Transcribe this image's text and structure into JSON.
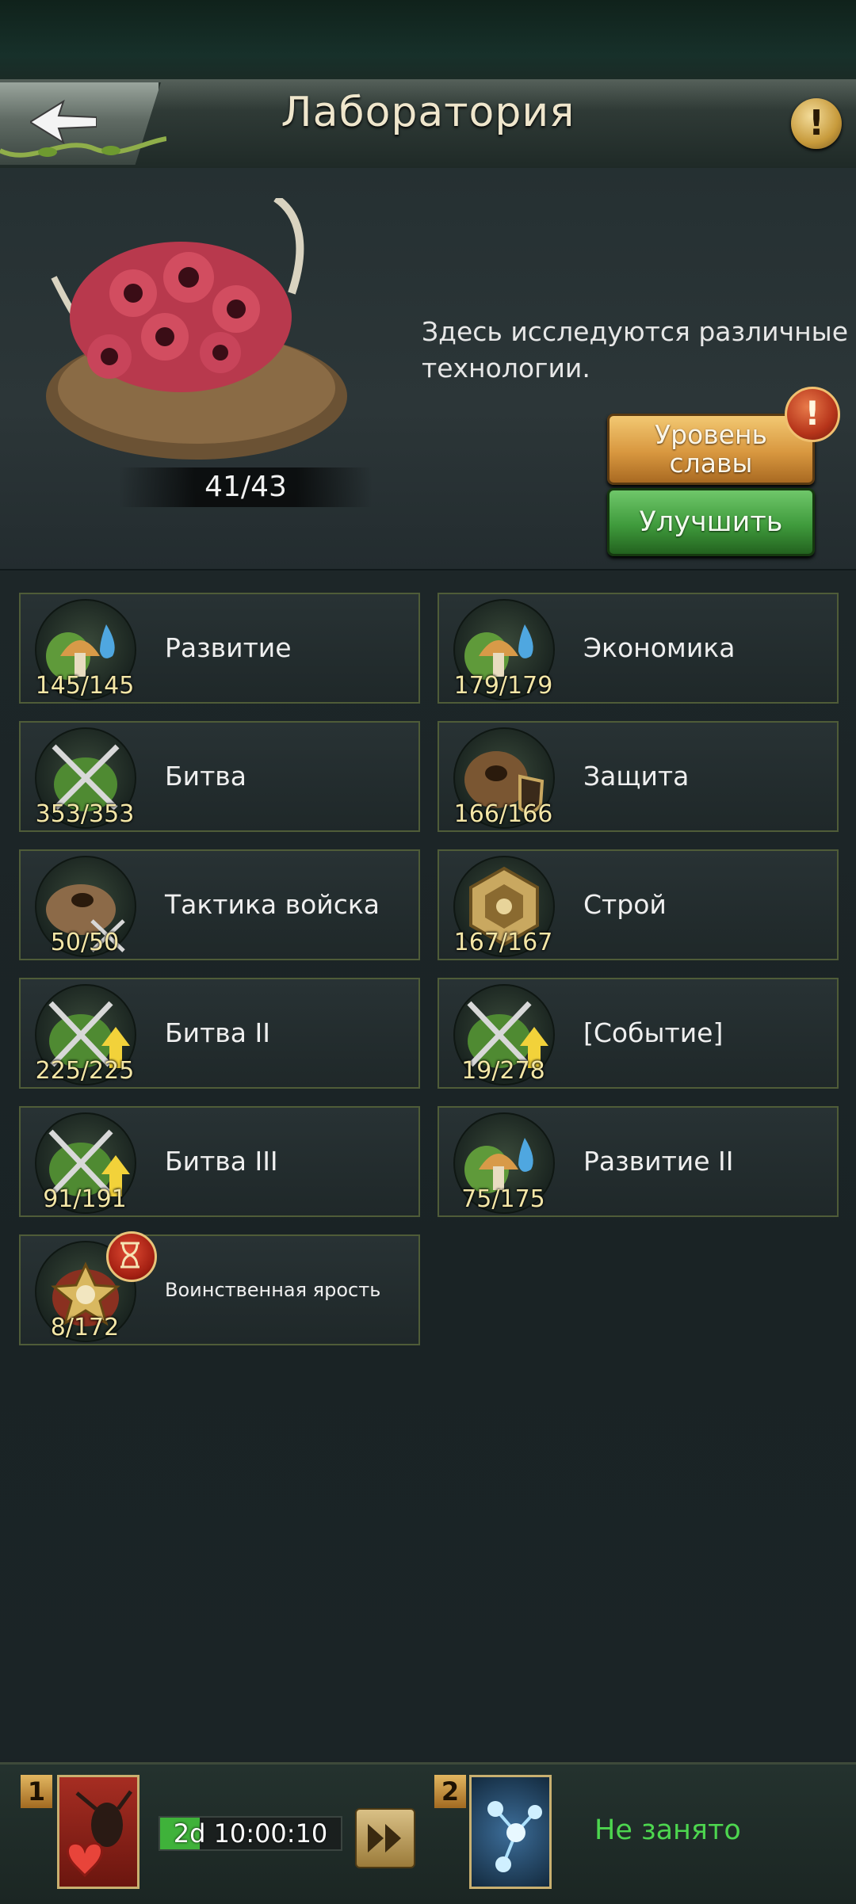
{
  "header": {
    "title": "Лаборатория"
  },
  "hero": {
    "level_progress": "41/43",
    "description": "Здесь исследуются различные технологии.",
    "glory_button": "Уровень славы",
    "upgrade_button": "Улучшить"
  },
  "categories": [
    {
      "name": "Развитие",
      "count": "145/145",
      "icon": "mushroom-water-icon"
    },
    {
      "name": "Экономика",
      "count": "179/179",
      "icon": "mushroom-water-icon"
    },
    {
      "name": "Битва",
      "count": "353/353",
      "icon": "crossed-swords-icon"
    },
    {
      "name": "Защита",
      "count": "166/166",
      "icon": "shield-nest-icon"
    },
    {
      "name": "Тактика войска",
      "count": "50/50",
      "icon": "nest-swords-icon"
    },
    {
      "name": "Строй",
      "count": "167/167",
      "icon": "formation-icon"
    },
    {
      "name": "Битва II",
      "count": "225/225",
      "icon": "swords-arrow-icon"
    },
    {
      "name": "[Событие]",
      "count": "19/278",
      "icon": "swords-arrow-icon"
    },
    {
      "name": "Битва III",
      "count": "91/191",
      "icon": "swords-arrow-icon"
    },
    {
      "name": "Развитие II",
      "count": "75/175",
      "icon": "mushroom-water-icon"
    },
    {
      "name": "Воинственная ярость",
      "count": "8/172",
      "icon": "rage-icon"
    }
  ],
  "queue": {
    "slot1_number": "1",
    "slot1_timer": "2d 10:00:10",
    "slot1_progress": 0.22,
    "slot2_number": "2",
    "slot2_status": "Не занято"
  },
  "colors": {
    "count_text": "#f3e6a6",
    "card_border": "#4f5c38",
    "status_free": "#4dd64f"
  }
}
